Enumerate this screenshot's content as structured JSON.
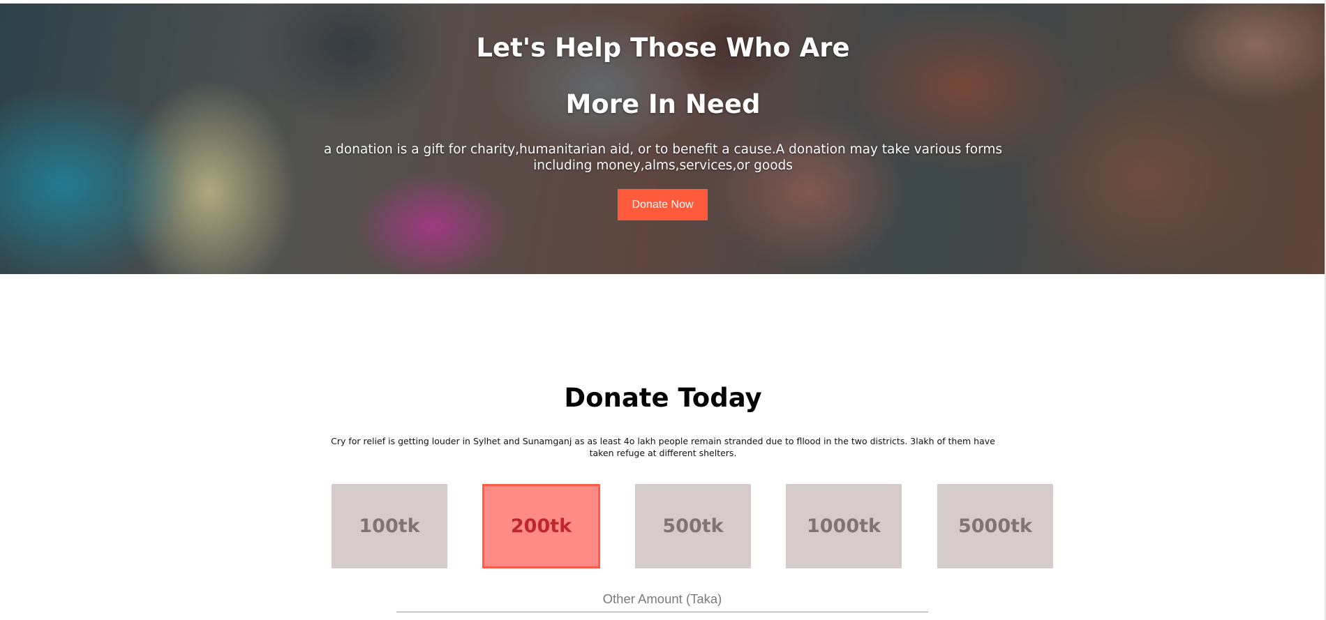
{
  "hero": {
    "title_line1": "Let's Help Those Who Are",
    "title_line2": "More In Need",
    "subtitle": "a donation is a gift for charity,humanitarian aid, or to benefit a cause.A donation may take various forms including money,alms,services,or goods",
    "cta_label": "Donate Now"
  },
  "donate": {
    "title": "Donate Today",
    "description": "Cry for relief is getting louder in Sylhet and Sunamganj as as least 4o lakh people remain stranded due to fllood in the two districts. 3lakh of them have taken refuge at different shelters.",
    "amounts": [
      {
        "label": "100tk",
        "selected": false
      },
      {
        "label": "200tk",
        "selected": true
      },
      {
        "label": "500tk",
        "selected": false
      },
      {
        "label": "1000tk",
        "selected": false
      },
      {
        "label": "5000tk",
        "selected": false
      }
    ],
    "other_amount_placeholder": "Other Amount (Taka)"
  },
  "colors": {
    "accent": "#ff5a3c",
    "tile": "#d6cbcb",
    "tile_text": "#7d7574",
    "tile_selected": "#ff8b86",
    "tile_selected_text": "#c0272d"
  }
}
